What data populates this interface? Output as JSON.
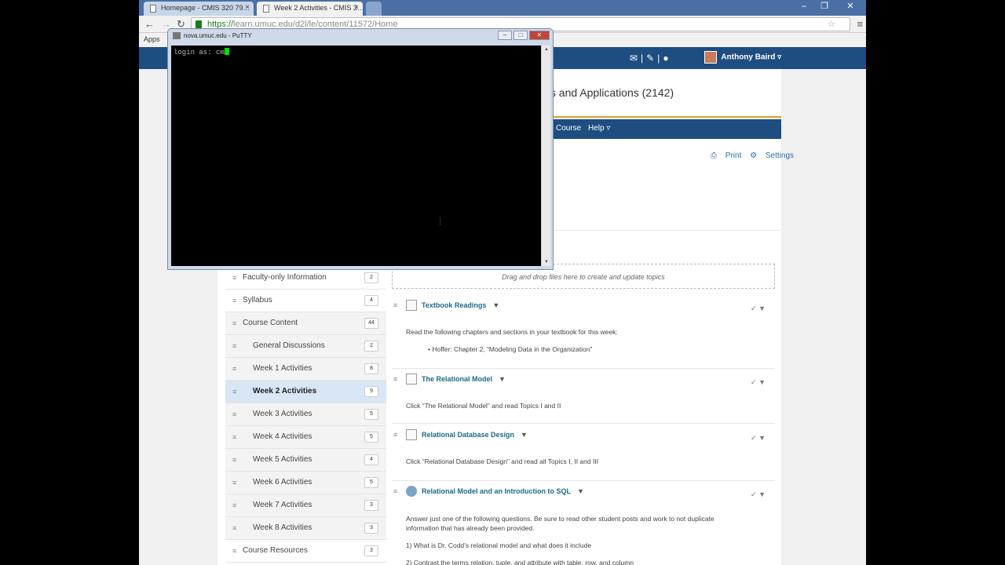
{
  "browser": {
    "tabs": [
      {
        "title": "Homepage - CMIS 320 79…",
        "close": "×"
      },
      {
        "title": "Week 2 Activities - CMIS 3…",
        "close": "×"
      }
    ],
    "window_controls": {
      "minimize": "–",
      "restore": "❐",
      "close": "✕"
    },
    "nav": {
      "back": "←",
      "forward": "→",
      "reload": "↻",
      "menu": "≡"
    },
    "address": {
      "scheme": "https://",
      "url_rest": "learn.umuc.edu/d2l/le/content/11572/Home"
    },
    "bookmarks": {
      "apps_label": "Apps"
    }
  },
  "site": {
    "user_name": "Anthony Baird",
    "course_title": "ts and Applications (2142)",
    "navbar": {
      "course": "Course",
      "help": "Help ▿"
    },
    "print_label": "Print",
    "settings_label": "Settings"
  },
  "left_nav": {
    "items": [
      {
        "label": "Faculty-only Information",
        "count": "2"
      },
      {
        "label": "Syllabus",
        "count": "4"
      },
      {
        "label": "Course Content",
        "count": "44"
      },
      {
        "label": "General Discussions",
        "count": "2"
      },
      {
        "label": "Week 1 Activities",
        "count": "8"
      },
      {
        "label": "Week 2 Activities",
        "count": "9"
      },
      {
        "label": "Week 3 Activities",
        "count": "5"
      },
      {
        "label": "Week 4 Activities",
        "count": "5"
      },
      {
        "label": "Week 5 Activities",
        "count": "4"
      },
      {
        "label": "Week 6 Activities",
        "count": "5"
      },
      {
        "label": "Week 7 Activities",
        "count": "3"
      },
      {
        "label": "Week 8 Activities",
        "count": "3"
      },
      {
        "label": "Course Resources",
        "count": "3"
      }
    ],
    "active_label": "Week 2 Activities"
  },
  "content": {
    "dropzone": "Drag and drop files here to create and update topics",
    "topics": [
      {
        "title": "Textbook Readings",
        "desc": "Read the following chapters and sections in your textbook for this week:",
        "bullet": "•   Hoffer: Chapter 2, “Modeling Data in the Organization”"
      },
      {
        "title": "The Relational Model",
        "desc": "Click “The Relational Model” and read Topics I and II"
      },
      {
        "title": "Relational Database Design",
        "desc": "Click “Relational Database Design” and read all Topics I, II  and III"
      },
      {
        "title": "Relational Model and an Introduction to SQL",
        "desc": "Answer just one of the following questions. Be sure to read other student posts and work to not duplicate",
        "desc2": "information that has already been provided.",
        "q1": "1) What is Dr. Codd’s relational model and what does it include",
        "q2": "2) Contrast the terms relation, tuple, and attribute with table, row, and column"
      }
    ]
  },
  "putty": {
    "title": "nova.umuc.edu - PuTTY",
    "prompt": "login as: cm"
  }
}
